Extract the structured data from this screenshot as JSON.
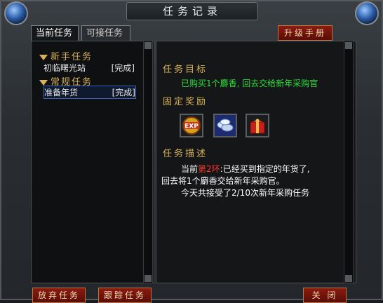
{
  "window": {
    "title": "任务记录"
  },
  "tabs": [
    {
      "label": "当前任务"
    },
    {
      "label": "可接任务"
    }
  ],
  "buttons": {
    "upgrade_manual": "升级手册",
    "abandon": "放弃任务",
    "track": "跟踪任务",
    "close": "关 闭"
  },
  "quest_list": {
    "categories": [
      {
        "name": "新手任务",
        "quests": [
          {
            "name": "初临曙光站",
            "status": "[完成]"
          }
        ]
      },
      {
        "name": "常规任务",
        "quests": [
          {
            "name": "准备年货",
            "status": "[完成]"
          }
        ]
      }
    ]
  },
  "detail": {
    "goal_heading": "任务目标",
    "goal_text": "已购买1个麝香, 回去交给新年采购官",
    "reward_heading": "固定奖励",
    "rewards": [
      {
        "icon": "exp-icon"
      },
      {
        "icon": "silver-coins-icon"
      },
      {
        "icon": "gift-box-icon"
      }
    ],
    "desc_heading": "任务描述",
    "desc_prefix": "当前",
    "desc_ring": "第2环",
    "desc_line1_rest": ":已经买到指定的年货了,",
    "desc_line2": "回去将1个麝香交给新年采购官。",
    "desc_line3": "今天共接受了2/10次新年采购任务"
  },
  "colors": {
    "heading": "#d8b25a",
    "goal": "#2ede3a",
    "highlight": "#ff3a2a",
    "button_red": "#8b1b12"
  }
}
